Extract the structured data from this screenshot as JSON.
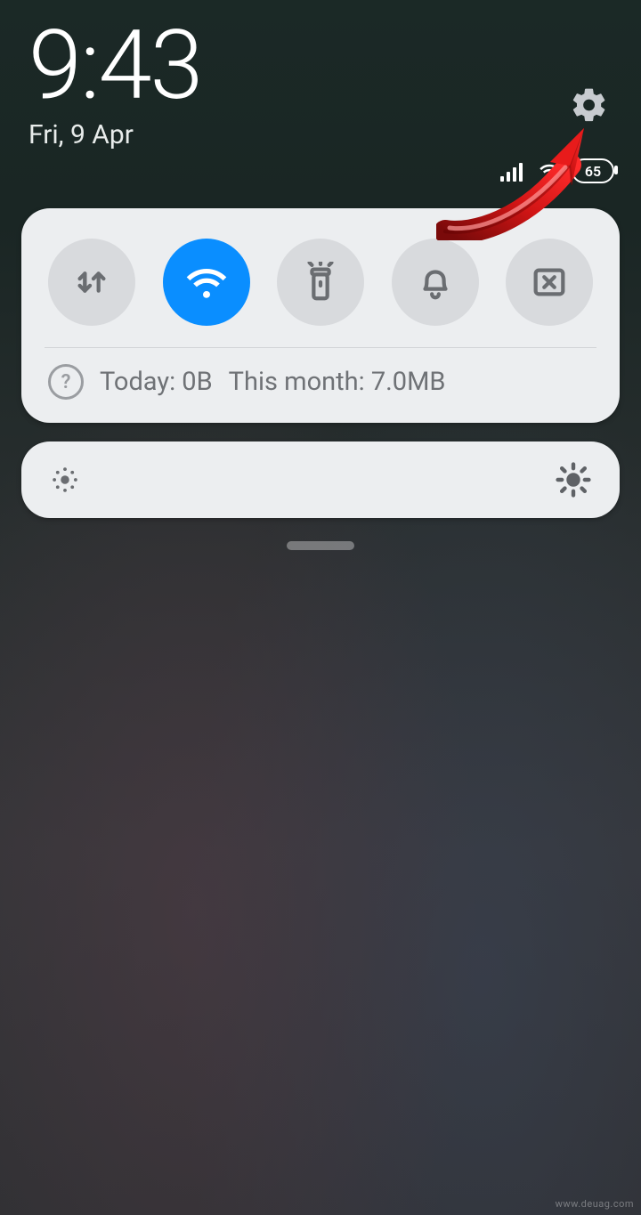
{
  "header": {
    "time": "9:43",
    "date": "Fri, 9 Apr",
    "battery_percent": "65"
  },
  "quick_settings": {
    "toggles": [
      {
        "name": "mobile-data",
        "active": false
      },
      {
        "name": "wifi",
        "active": true
      },
      {
        "name": "flashlight",
        "active": false
      },
      {
        "name": "sound",
        "active": false
      },
      {
        "name": "screenshot",
        "active": false
      }
    ],
    "data_usage": {
      "today_label": "Today: 0B",
      "month_label": "This month: 7.0MB"
    }
  },
  "colors": {
    "accent": "#0a8eff",
    "card_bg": "#eceef0",
    "toggle_off": "#d8dadd",
    "icon_muted": "#6a6d71"
  },
  "watermark": "www.deuag.com"
}
